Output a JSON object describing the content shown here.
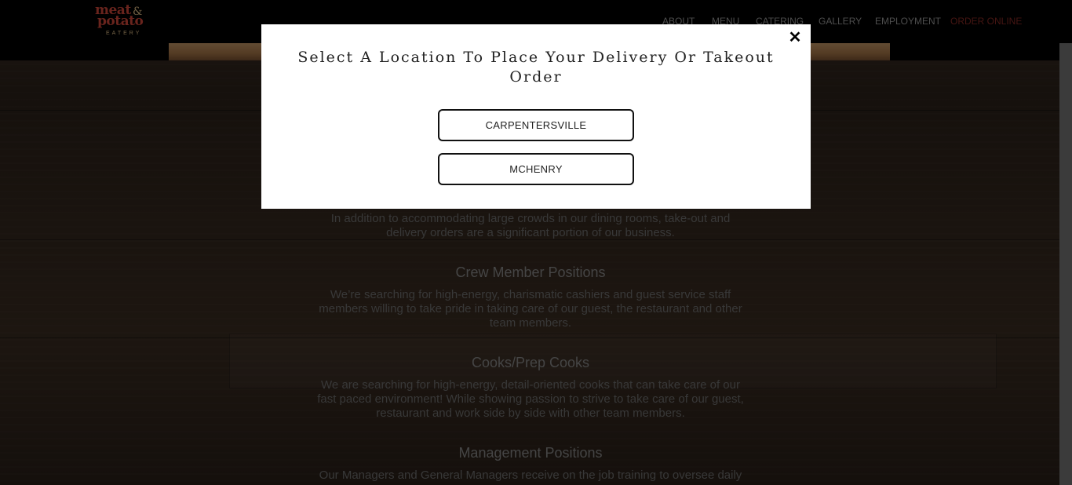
{
  "brand": {
    "logo_line1": "meat",
    "logo_amp": "&",
    "logo_line2": "potato",
    "logo_line3": "EATERY"
  },
  "nav": {
    "items": [
      "ABOUT",
      "MENU",
      "CATERING",
      "GALLERY",
      "EMPLOYMENT"
    ],
    "order_online": "ORDER ONLINE"
  },
  "content": {
    "intro_line1": "In addition to accommodating large crowds in our dining rooms, take-out and",
    "intro_line2": "delivery orders are a significant portion of our business.",
    "sections": [
      {
        "title": "Crew Member Positions",
        "lines": [
          "We’re searching for high-energy, charismatic cashiers and guest service staff",
          "members willing to take pride in taking care of our guest, the restaurant and other",
          "team members."
        ]
      },
      {
        "title": "Cooks/Prep Cooks",
        "lines": [
          "We are searching for high-energy, detail-oriented cooks that can take care of our",
          "fast paced environment! While showing passion to strive to take care of our guest,",
          "restaurant and work side by side with other team members."
        ]
      },
      {
        "title": "Management Positions",
        "lines": [
          "Our Managers and General Managers receive on the job training to oversee daily"
        ]
      }
    ]
  },
  "modal": {
    "title": "Select A Location To Place Your Delivery Or Takeout Order",
    "close_symbol": "✕",
    "locations": [
      "CARPENTERSVILLE",
      "MCHENRY"
    ]
  },
  "colors": {
    "accent_order": "#8b2a24",
    "logo_red": "#d2483a",
    "logo_tan": "#e5c28a"
  }
}
